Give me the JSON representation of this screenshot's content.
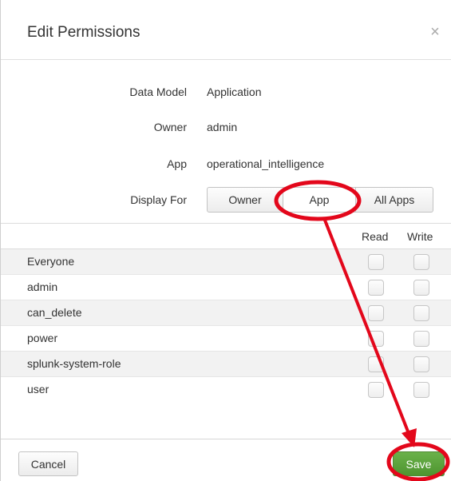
{
  "dialog": {
    "title": "Edit Permissions",
    "close_label": "×"
  },
  "fields": {
    "data_model_label": "Data Model",
    "data_model_value": "Application",
    "owner_label": "Owner",
    "owner_value": "admin",
    "app_label": "App",
    "app_value": "operational_intelligence",
    "display_for_label": "Display For"
  },
  "display_for": {
    "options": [
      "Owner",
      "App",
      "All Apps"
    ],
    "selected": "App"
  },
  "permissions": {
    "columns": {
      "read": "Read",
      "write": "Write"
    },
    "roles": [
      {
        "name": "Everyone"
      },
      {
        "name": "admin"
      },
      {
        "name": "can_delete"
      },
      {
        "name": "power"
      },
      {
        "name": "splunk-system-role"
      },
      {
        "name": "user"
      }
    ]
  },
  "footer": {
    "cancel_label": "Cancel",
    "save_label": "Save"
  },
  "colors": {
    "annotation": "#e3071b",
    "save_green": "#5aa23b"
  }
}
